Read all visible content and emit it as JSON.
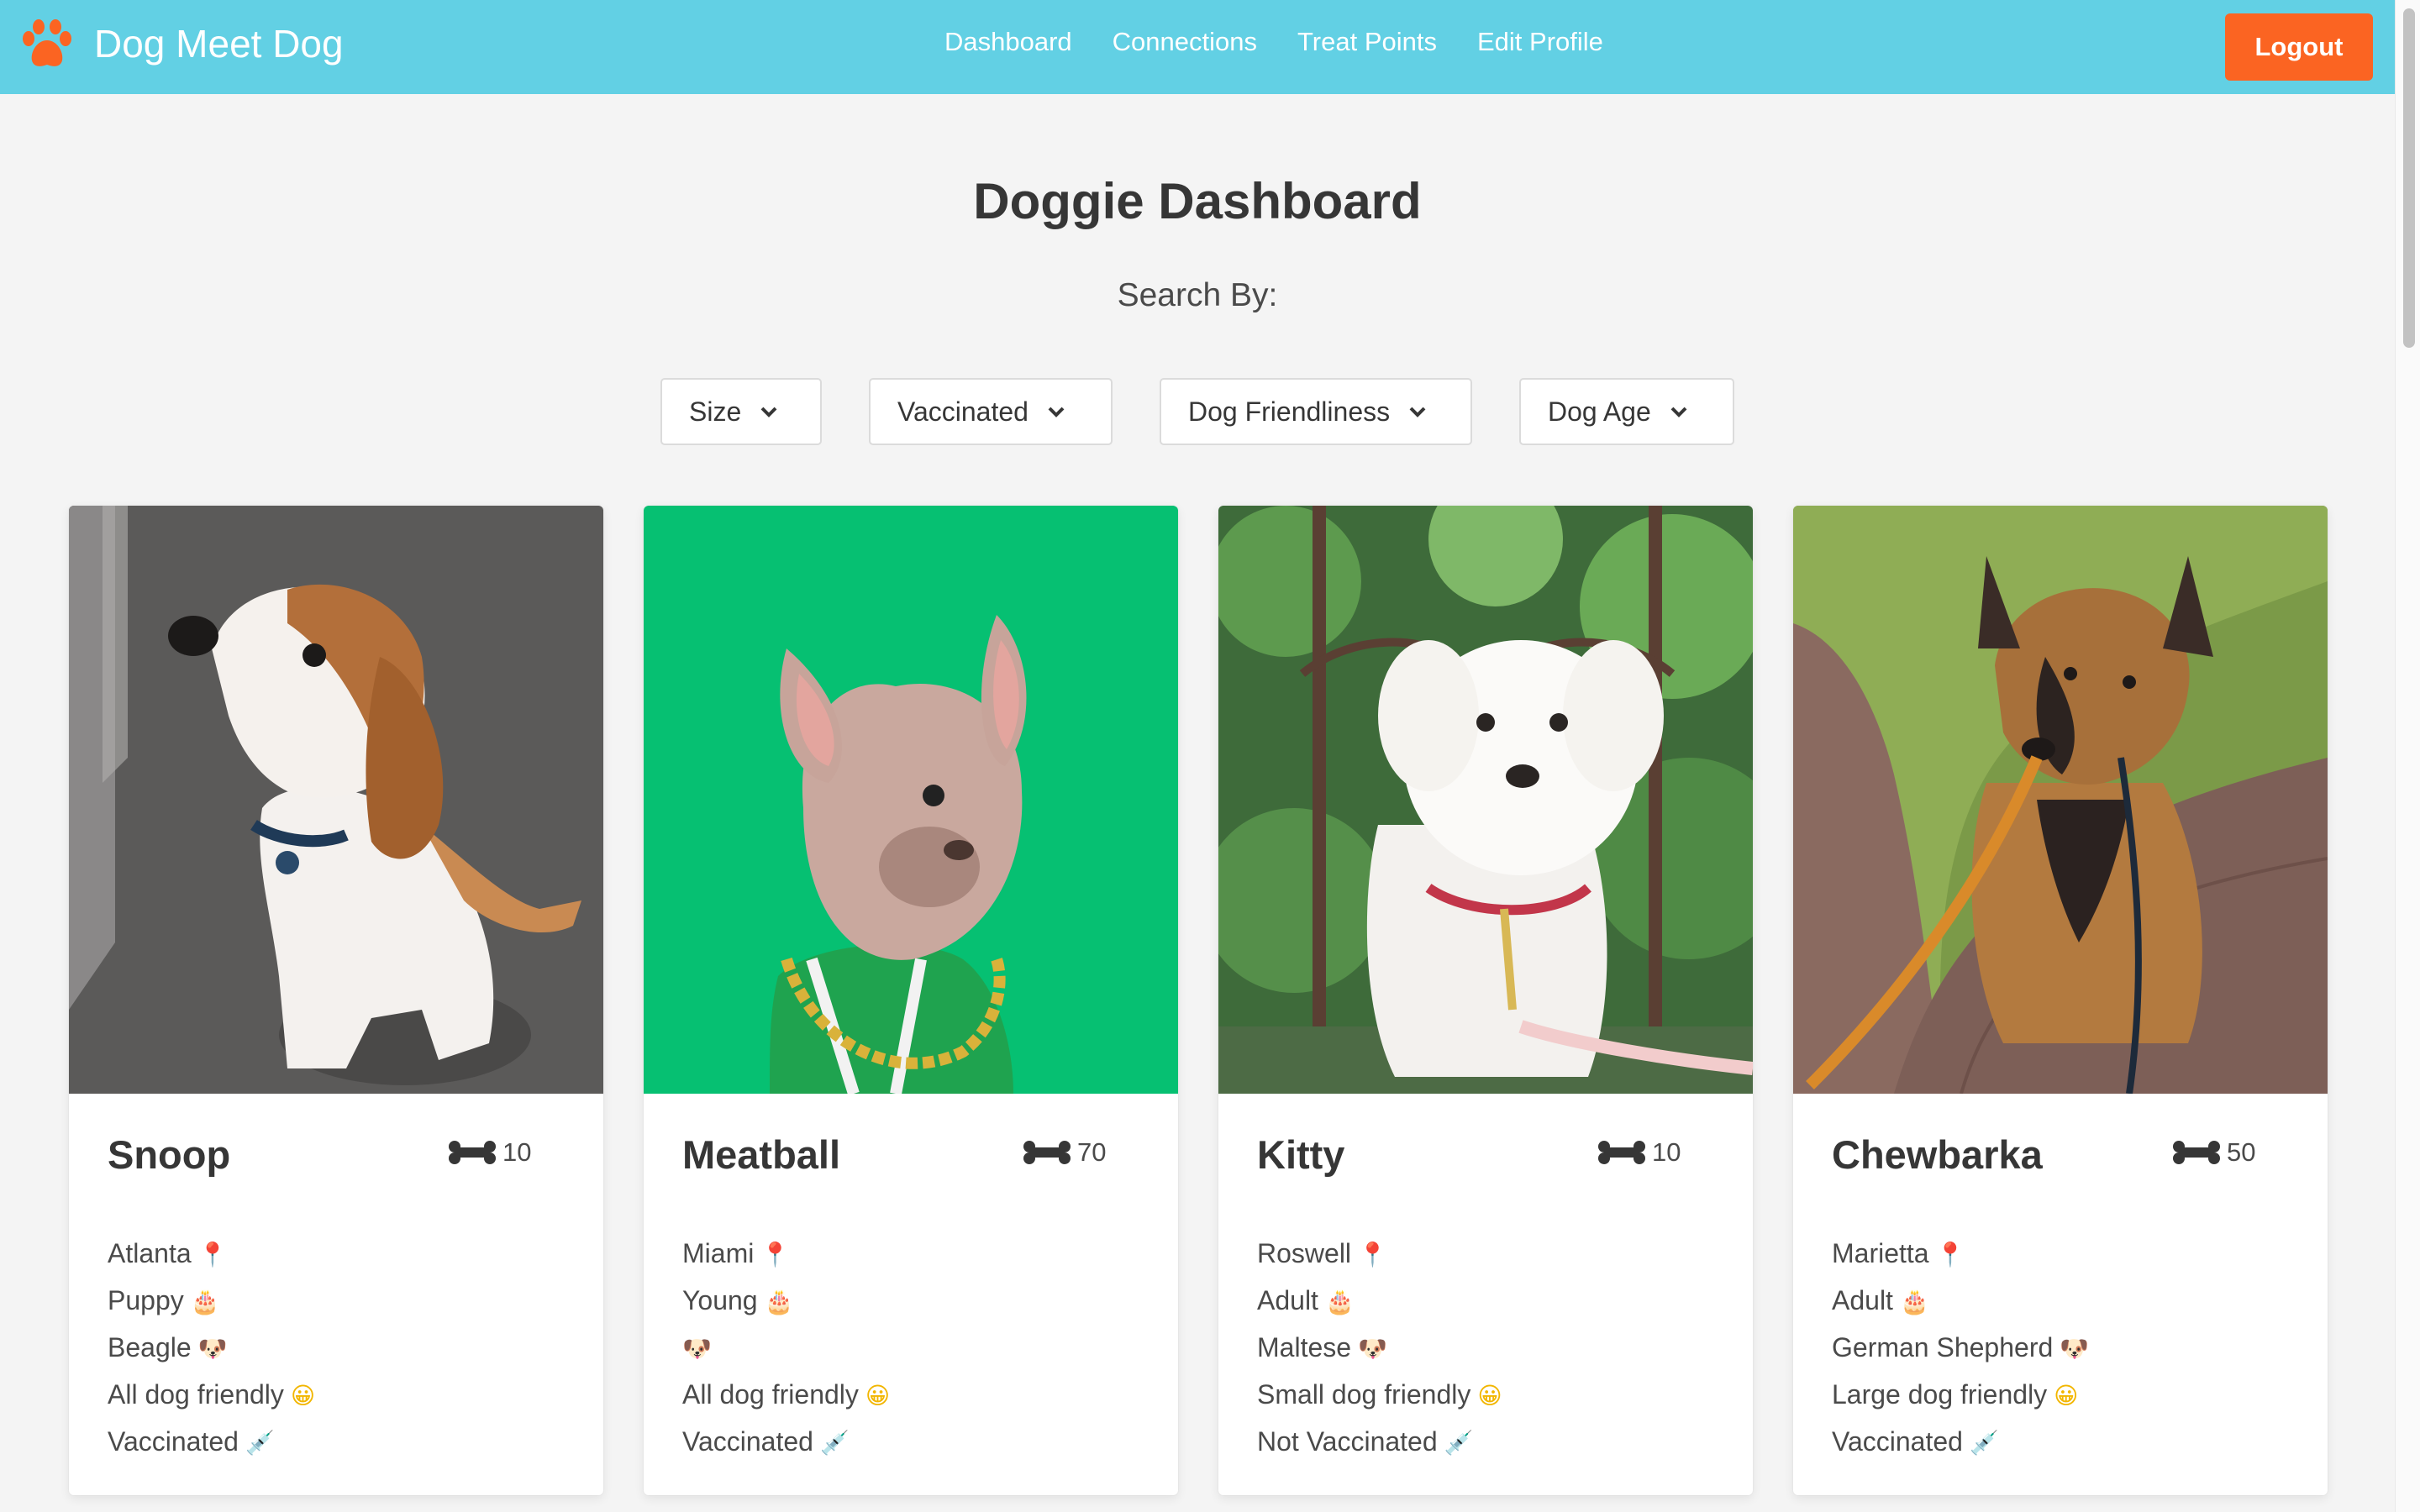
{
  "nav": {
    "brand": "Dog Meet Dog",
    "links": [
      "Dashboard",
      "Connections",
      "Treat Points",
      "Edit Profile"
    ],
    "logout": "Logout"
  },
  "page": {
    "title": "Doggie Dashboard",
    "search_label": "Search By:"
  },
  "filters": [
    "Size",
    "Vaccinated",
    "Dog Friendliness",
    "Dog Age"
  ],
  "icons": {
    "location": "📍",
    "age": "🎂",
    "breed": "🐶",
    "friendly": "😀",
    "vaccine": "💉"
  },
  "dogs": [
    {
      "name": "Snoop",
      "points": "10",
      "city": "Atlanta",
      "age": "Puppy",
      "breed": "Beagle",
      "friendliness": "All dog friendly",
      "vaccinated": "Vaccinated"
    },
    {
      "name": "Meatball",
      "points": "70",
      "city": "Miami",
      "age": "Young",
      "breed": "",
      "friendliness": "All dog friendly",
      "vaccinated": "Vaccinated"
    },
    {
      "name": "Kitty",
      "points": "10",
      "city": "Roswell",
      "age": "Adult",
      "breed": "Maltese",
      "friendliness": "Small dog friendly",
      "vaccinated": "Not Vaccinated"
    },
    {
      "name": "Chewbarka",
      "points": "50",
      "city": "Marietta",
      "age": "Adult",
      "breed": "German Shepherd",
      "friendliness": "Large dog friendly",
      "vaccinated": "Vaccinated"
    }
  ],
  "colors": {
    "navbar": "#62d0e4",
    "logout": "#fb6422",
    "paw": "#fb6422",
    "background": "#f4f4f4"
  }
}
